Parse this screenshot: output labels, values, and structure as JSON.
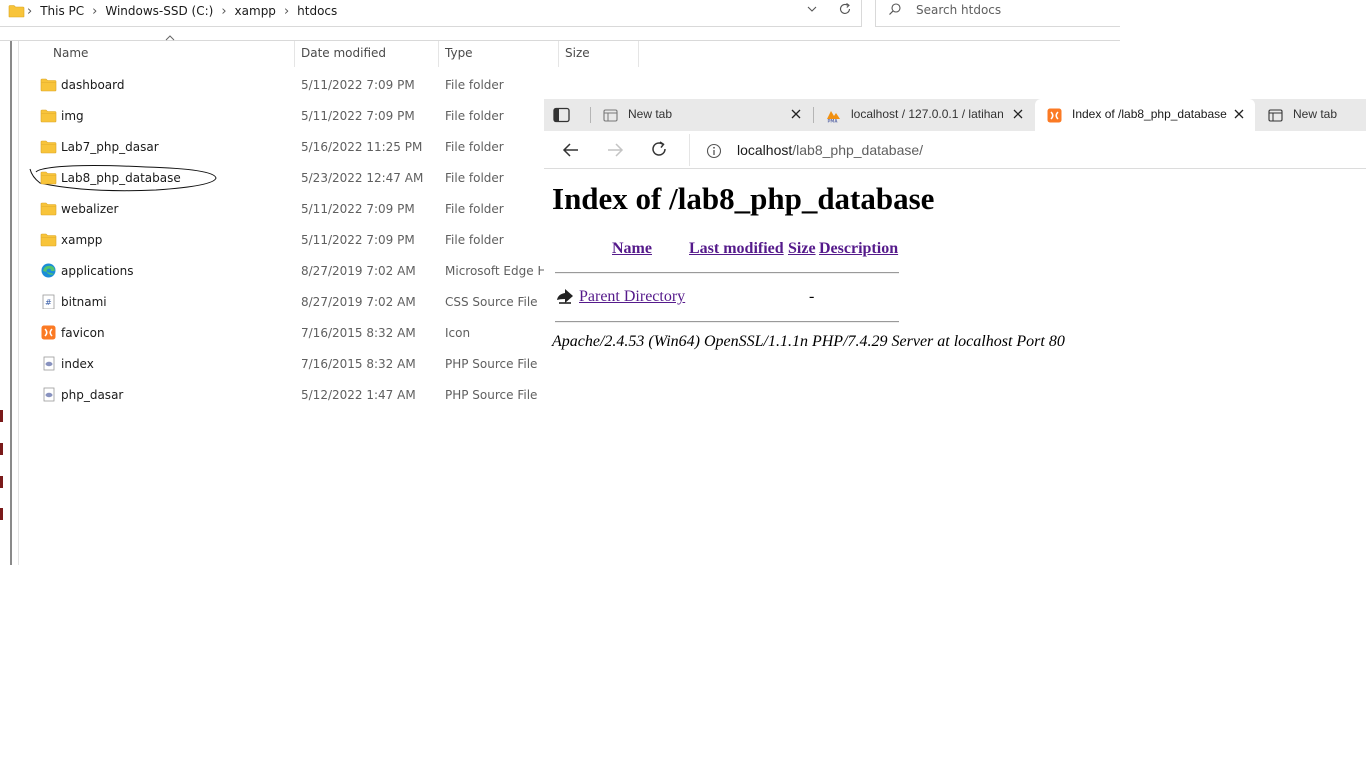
{
  "explorer": {
    "breadcrumb": [
      "This PC",
      "Windows-SSD (C:)",
      "xampp",
      "htdocs"
    ],
    "search_placeholder": "Search htdocs",
    "columns": {
      "name": "Name",
      "date": "Date modified",
      "type": "Type",
      "size": "Size"
    },
    "files": [
      {
        "name": "dashboard",
        "date": "5/11/2022 7:09 PM",
        "type": "File folder",
        "icon": "folder-icon"
      },
      {
        "name": "img",
        "date": "5/11/2022 7:09 PM",
        "type": "File folder",
        "icon": "folder-icon"
      },
      {
        "name": "Lab7_php_dasar",
        "date": "5/16/2022 11:25 PM",
        "type": "File folder",
        "icon": "folder-icon"
      },
      {
        "name": "Lab8_php_database",
        "date": "5/23/2022 12:47 AM",
        "type": "File folder",
        "icon": "folder-icon"
      },
      {
        "name": "webalizer",
        "date": "5/11/2022 7:09 PM",
        "type": "File folder",
        "icon": "folder-icon"
      },
      {
        "name": "xampp",
        "date": "5/11/2022 7:09 PM",
        "type": "File folder",
        "icon": "folder-icon"
      },
      {
        "name": "applications",
        "date": "8/27/2019 7:02 AM",
        "type": "Microsoft Edge H..",
        "icon": "edge-html-icon"
      },
      {
        "name": "bitnami",
        "date": "8/27/2019 7:02 AM",
        "type": "CSS Source File",
        "icon": "css-file-icon"
      },
      {
        "name": "favicon",
        "date": "7/16/2015 8:32 AM",
        "type": "Icon",
        "icon": "xampp-icon"
      },
      {
        "name": "index",
        "date": "7/16/2015 8:32 AM",
        "type": "PHP Source File",
        "icon": "php-file-icon"
      },
      {
        "name": "php_dasar",
        "date": "5/12/2022 1:47 AM",
        "type": "PHP Source File",
        "icon": "php-file-icon"
      }
    ],
    "circled_item": "Lab8_php_database"
  },
  "browser": {
    "tabs": [
      {
        "label": "New tab",
        "icon": "new-tab-page-icon",
        "active": false
      },
      {
        "label": "localhost / 127.0.0.1 / latihan",
        "icon": "phpmyadmin-icon",
        "active": false
      },
      {
        "label": "Index of /lab8_php_database",
        "icon": "xampp-icon",
        "active": true
      },
      {
        "label": "New tab",
        "icon": "new-tab-page-icon",
        "active": false
      }
    ],
    "url_host": "localhost",
    "url_path": "/lab8_php_database/",
    "page": {
      "heading": "Index of /lab8_php_database",
      "columns": {
        "name": "Name",
        "last_modified": "Last modified",
        "size": "Size",
        "description": "Description"
      },
      "parent_link": "Parent Directory",
      "parent_size": "-",
      "address": "Apache/2.4.53 (Win64) OpenSSL/1.1.1n PHP/7.4.29 Server at localhost Port 80"
    }
  },
  "colors": {
    "folder": "#f8c43a",
    "visited_link": "#551a8b",
    "tabstrip_bg": "#e9e9e9",
    "edge_marks": "#7a1a1a"
  }
}
